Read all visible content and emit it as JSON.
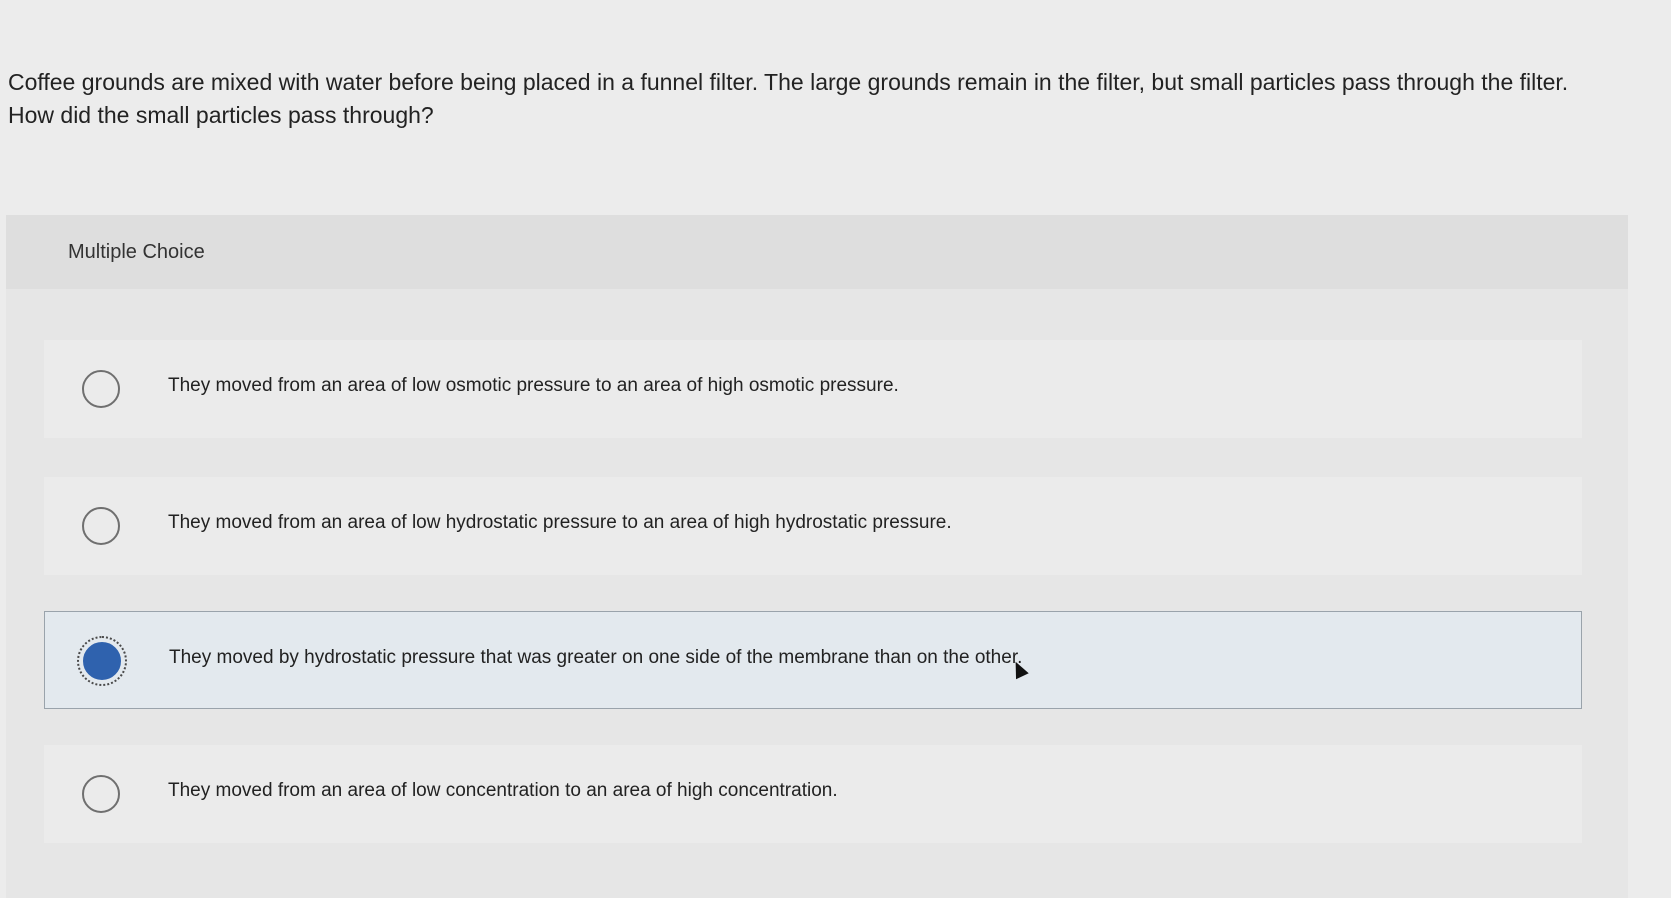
{
  "question": {
    "text": "Coffee grounds are mixed with water before being placed in a funnel filter. The large grounds remain in the filter, but small particles pass through the filter. How did the small particles pass through?"
  },
  "multiple_choice": {
    "label": "Multiple Choice",
    "selected_index": 2,
    "options": [
      {
        "text": "They moved from an area of low osmotic pressure to an area of high osmotic pressure."
      },
      {
        "text": "They moved from an area of low hydrostatic pressure to an area of high hydrostatic pressure."
      },
      {
        "text": "They moved by hydrostatic pressure that was greater on one side of the membrane than on the other."
      },
      {
        "text": "They moved from an area of low concentration to an area of high concentration."
      }
    ]
  },
  "colors": {
    "selected_radio": "#2f62ae",
    "selected_background": "#e3e9ee"
  }
}
